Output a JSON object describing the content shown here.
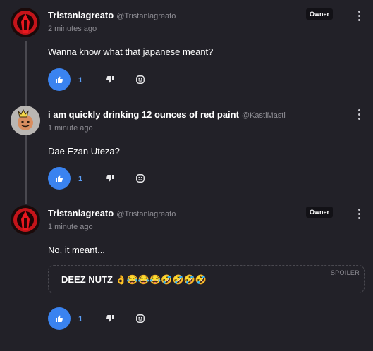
{
  "comments": [
    {
      "name": "Tristanlagreato",
      "handle": "@Tristanlagreato",
      "time": "2 minutes ago",
      "badge": "Owner",
      "text": "Wanna know what that japanese meant?",
      "likes": "1",
      "avatar_icon": "red-skull-avatar"
    },
    {
      "name": "i am quickly drinking 12 ounces of red paint",
      "handle": "@KastiMasti",
      "time": "1 minute ago",
      "text": "Dae Ezan Uteza?",
      "likes": "1",
      "avatar_icon": "cartoon-king-avatar"
    },
    {
      "name": "Tristanlagreato",
      "handle": "@Tristanlagreato",
      "time": "1 minute ago",
      "badge": "Owner",
      "text": "No, it meant...",
      "spoiler_label": "SPOILER",
      "spoiler_text": "DEEZ NUTZ 👌😂😂😂🤣🤣🤣🤣",
      "likes": "1",
      "avatar_icon": "red-skull-avatar"
    }
  ],
  "colors": {
    "background": "#222128",
    "accent": "#3a83f0",
    "like_count": "#5b9ef7",
    "muted": "#8e8d94"
  }
}
